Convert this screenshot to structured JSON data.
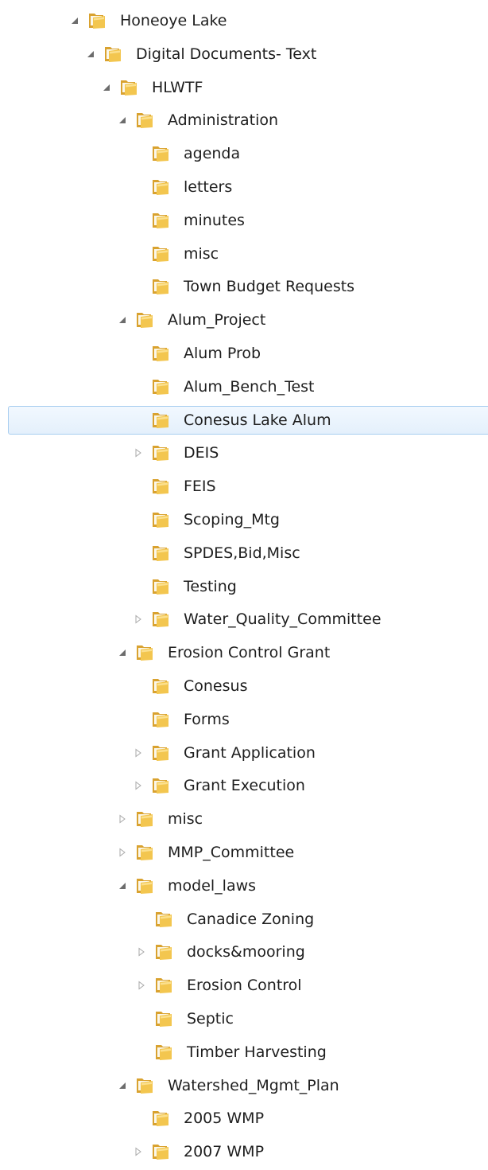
{
  "tree": [
    {
      "label": "Honeoye Lake",
      "level": 0,
      "arrow": "expanded"
    },
    {
      "label": "Digital Documents- Text",
      "level": 1,
      "arrow": "expanded"
    },
    {
      "label": "HLWTF",
      "level": 2,
      "arrow": "expanded"
    },
    {
      "label": "Administration",
      "level": 3,
      "arrow": "expanded"
    },
    {
      "label": "agenda",
      "level": 4,
      "arrow": "none"
    },
    {
      "label": "letters",
      "level": 4,
      "arrow": "none"
    },
    {
      "label": "minutes",
      "level": 4,
      "arrow": "none"
    },
    {
      "label": "misc",
      "level": 4,
      "arrow": "none"
    },
    {
      "label": "Town Budget Requests",
      "level": 4,
      "arrow": "none"
    },
    {
      "label": "Alum_Project",
      "level": 3,
      "arrow": "expanded"
    },
    {
      "label": "Alum Prob",
      "level": 4,
      "arrow": "none"
    },
    {
      "label": "Alum_Bench_Test",
      "level": 4,
      "arrow": "none"
    },
    {
      "label": "Conesus Lake Alum",
      "level": 4,
      "arrow": "none",
      "selected": true
    },
    {
      "label": "DEIS",
      "level": 4,
      "arrow": "collapsed"
    },
    {
      "label": "FEIS",
      "level": 4,
      "arrow": "none"
    },
    {
      "label": "Scoping_Mtg",
      "level": 4,
      "arrow": "none"
    },
    {
      "label": "SPDES,Bid,Misc",
      "level": 4,
      "arrow": "none"
    },
    {
      "label": "Testing",
      "level": 4,
      "arrow": "none"
    },
    {
      "label": "Water_Quality_Committee",
      "level": 4,
      "arrow": "collapsed"
    },
    {
      "label": "Erosion Control Grant",
      "level": 3,
      "arrow": "expanded"
    },
    {
      "label": "Conesus",
      "level": 4,
      "arrow": "none"
    },
    {
      "label": "Forms",
      "level": 4,
      "arrow": "none"
    },
    {
      "label": "Grant Application",
      "level": 4,
      "arrow": "collapsed"
    },
    {
      "label": "Grant Execution",
      "level": 4,
      "arrow": "collapsed"
    },
    {
      "label": "misc",
      "level": 3,
      "arrow": "collapsed"
    },
    {
      "label": "MMP_Committee",
      "level": 3,
      "arrow": "collapsed"
    },
    {
      "label": "model_laws",
      "level": 3,
      "arrow": "expanded"
    },
    {
      "label": "Canadice Zoning",
      "level": 4,
      "arrow": "none"
    },
    {
      "label": "docks&mooring",
      "level": 4,
      "arrow": "collapsed"
    },
    {
      "label": "Erosion Control",
      "level": 4,
      "arrow": "collapsed"
    },
    {
      "label": "Septic",
      "level": 4,
      "arrow": "none"
    },
    {
      "label": "Timber Harvesting",
      "level": 4,
      "arrow": "none"
    },
    {
      "label": "Watershed_Mgmt_Plan",
      "level": 3,
      "arrow": "expanded"
    },
    {
      "label": "2005 WMP",
      "level": 4,
      "arrow": "none"
    },
    {
      "label": "2007 WMP",
      "level": 4,
      "arrow": "collapsed"
    }
  ],
  "colors": {
    "selection_border": "#a7cdf0",
    "selection_fill": "#e4f0fc",
    "folder_body": "#f3c64f",
    "folder_back": "#d9a22f",
    "arrow": "#6c6c6c"
  }
}
